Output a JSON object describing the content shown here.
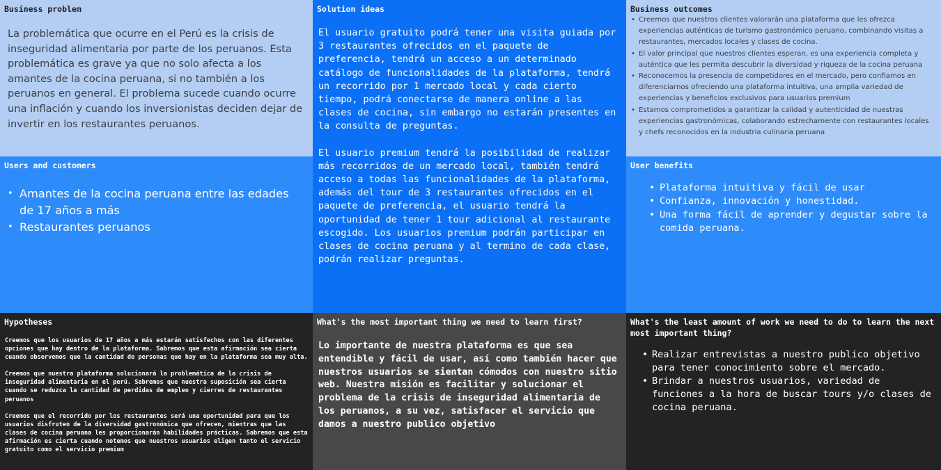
{
  "business_problem": {
    "title": "Business problem",
    "text": "La problemática que ocurre en el Perú es la crisis de inseguridad alimentaria por parte de los peruanos. Esta problemática es grave ya que no solo afecta a los amantes de la cocina peruana, si no también a los peruanos en general. El problema sucede cuando ocurre una inflación y cuando los inversionistas deciden dejar de invertir en los restaurantes peruanos."
  },
  "solution_ideas": {
    "title": "Solution ideas",
    "paragraphs": [
      "El usuario gratuito podrá tener una visita guiada por 3 restaurantes ofrecidos en el paquete de preferencia, tendrá un acceso a un determinado catálogo de funcionalidades de la plataforma, tendrá un recorrido por 1 mercado local y cada cierto tiempo, podrá conectarse de manera online a las clases de cocina, sin embargo no estarán presentes en la consulta de preguntas.",
      "El usuario premium tendrá la posibilidad de realizar más recorridos de un mercado local, también tendrá acceso a todas las funcionalidades de la plataforma, además del tour de 3 restaurantes ofrecidos en el paquete de preferencia, el usuario tendrá la oportunidad de tener 1 tour adicional al restaurante escogido. Los usuarios premium podrán participar en clases de cocina peruana y al termino de cada clase, podrán realizar preguntas."
    ]
  },
  "business_outcomes": {
    "title": "Business outcomes",
    "items": [
      "Creemos que nuestros clientes valorarán una plataforma que les ofrezca experiencias auténticas de turismo gastronómico peruano, combinando visitas a restaurantes, mercados locales y clases de cocina.",
      "El valor principal que nuestros clientes esperan, es una experiencia completa y auténtica que les permita descubrir la diversidad y riqueza de la cocina peruana",
      "Reconocemos la presencia de competidores en el mercado, pero confiamos en diferenciarnos ofreciendo una plataforma intuitiva, una amplia variedad de experiencias y beneficios exclusivos para usuarios premium",
      "Estamos comprometidos a garantizar la calidad y autenticidad de nuestras experiencias gastronómicas, colaborando estrechamente con restaurantes locales y chefs reconocidos en la industria culinaria peruana"
    ]
  },
  "users_and_customers": {
    "title": "Users and customers",
    "items": [
      "Amantes de la cocina peruana entre las edades de 17 años a más",
      "Restaurantes peruanos"
    ]
  },
  "user_benefits": {
    "title": "User benefits",
    "items": [
      "Plataforma intuitiva y fácil de usar",
      "Confianza, innovación y honestidad.",
      "Una forma fácil de aprender y degustar sobre la comida peruana."
    ]
  },
  "hypotheses": {
    "title": "Hypotheses",
    "paragraphs": [
      "Creemos que los usuarios de 17 años a más estarán satisfechos con las diferentes opciones que hay dentro de la plataforma. Sabremos que esta afirmación sea cierta cuando observemos que la cantidad de personas que hay en la plataforma sea muy alta.",
      "Creemos que nuestra plataforma solucionará la problemática de la crisis de inseguridad alimentaria en el perú. Sabremos que nuestra suposición sea cierta cuando se reduzca la cantidad de perdidas de empleo y cierres de restaurantes peruanos",
      "Creemos que el recorrido por los restaurantes será una oportunidad para que los usuarios disfruten de la diversidad gastronómica que ofrecen, mientras que las clases de cocina peruana les proporcionarán habilidades prácticas. Sabremos que esta afirmación es cierta cuando notemos que nuestros usuarios eligen tanto el servicio gratuito como el servicio premium"
    ]
  },
  "most_important": {
    "title": "What's the most important thing we need to learn first?",
    "text": "Lo importante de nuestra plataforma es que sea entendible y fácil de usar, así como también hacer que nuestros usuarios se sientan cómodos con nuestro sitio web. Nuestra misión es facilitar y solucionar el problema de la crisis de inseguridad alimentaria de los peruanos, a su vez, satisfacer el servicio que damos a nuestro publico objetivo"
  },
  "least_work": {
    "title": "What's the least amount of work we need to do to learn the next most important thing?",
    "items": [
      "Realizar entrevistas a nuestro publico objetivo para tener conocimiento sobre el mercado.",
      "Brindar a nuestros usuarios, variedad de funciones a la hora de buscar tours y/o clases de cocina peruana."
    ]
  },
  "colors": {
    "light_blue": "#b3cdf3",
    "mid_blue": "#2e8bfa",
    "deep_blue": "#0c70f7",
    "dark": "#232323",
    "gray": "#484848"
  }
}
